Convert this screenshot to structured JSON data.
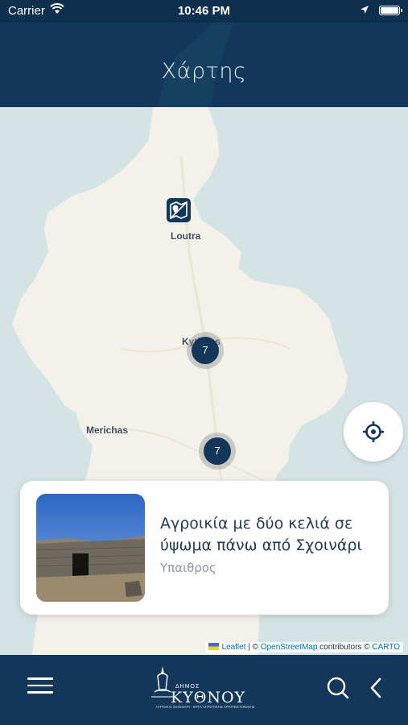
{
  "status_bar": {
    "carrier": "Carrier",
    "time": "10:46 PM",
    "icons": [
      "wifi-icon",
      "location-arrow-icon",
      "battery-icon"
    ]
  },
  "header": {
    "title": "Χάρτης"
  },
  "map": {
    "place_labels": [
      "Loutra",
      "Kythnos",
      "Merichas"
    ],
    "clusters": [
      {
        "count": "7"
      },
      {
        "count": "7"
      }
    ],
    "poi_icon": "map-pin-icon",
    "locate_icon": "crosshair-icon",
    "attribution": {
      "leaflet": "Leaflet",
      "separator": " | © ",
      "osm": "OpenStreetMap",
      "contributors": " contributors © ",
      "carto": "CARTO"
    }
  },
  "card": {
    "title": "Αγροικία με δύο κελιά σε ύψωμα πάνω από Σχοινάρι",
    "category": "Υπαιθρος"
  },
  "tab_bar": {
    "logo_small": "ΔΗΜΟΣ",
    "logo_big": "ΚΥΘΝΟΥ",
    "logo_tiny": "ΑΓΡΟΙΚΙΑ ΣΧΟΙΝΑΡΙ · ΕΡΓΑ ΑΓΡΟΤΙΚΗΣ ΑΡΧΙΤΕΚΤΟΝΙΚΗΣ",
    "icons": [
      "menu-icon",
      "search-icon",
      "back-chevron-icon"
    ]
  },
  "colors": {
    "navy": "#12375a",
    "sea": "#d4e4e4",
    "land": "#f4f1ea",
    "link": "#0078a8"
  }
}
